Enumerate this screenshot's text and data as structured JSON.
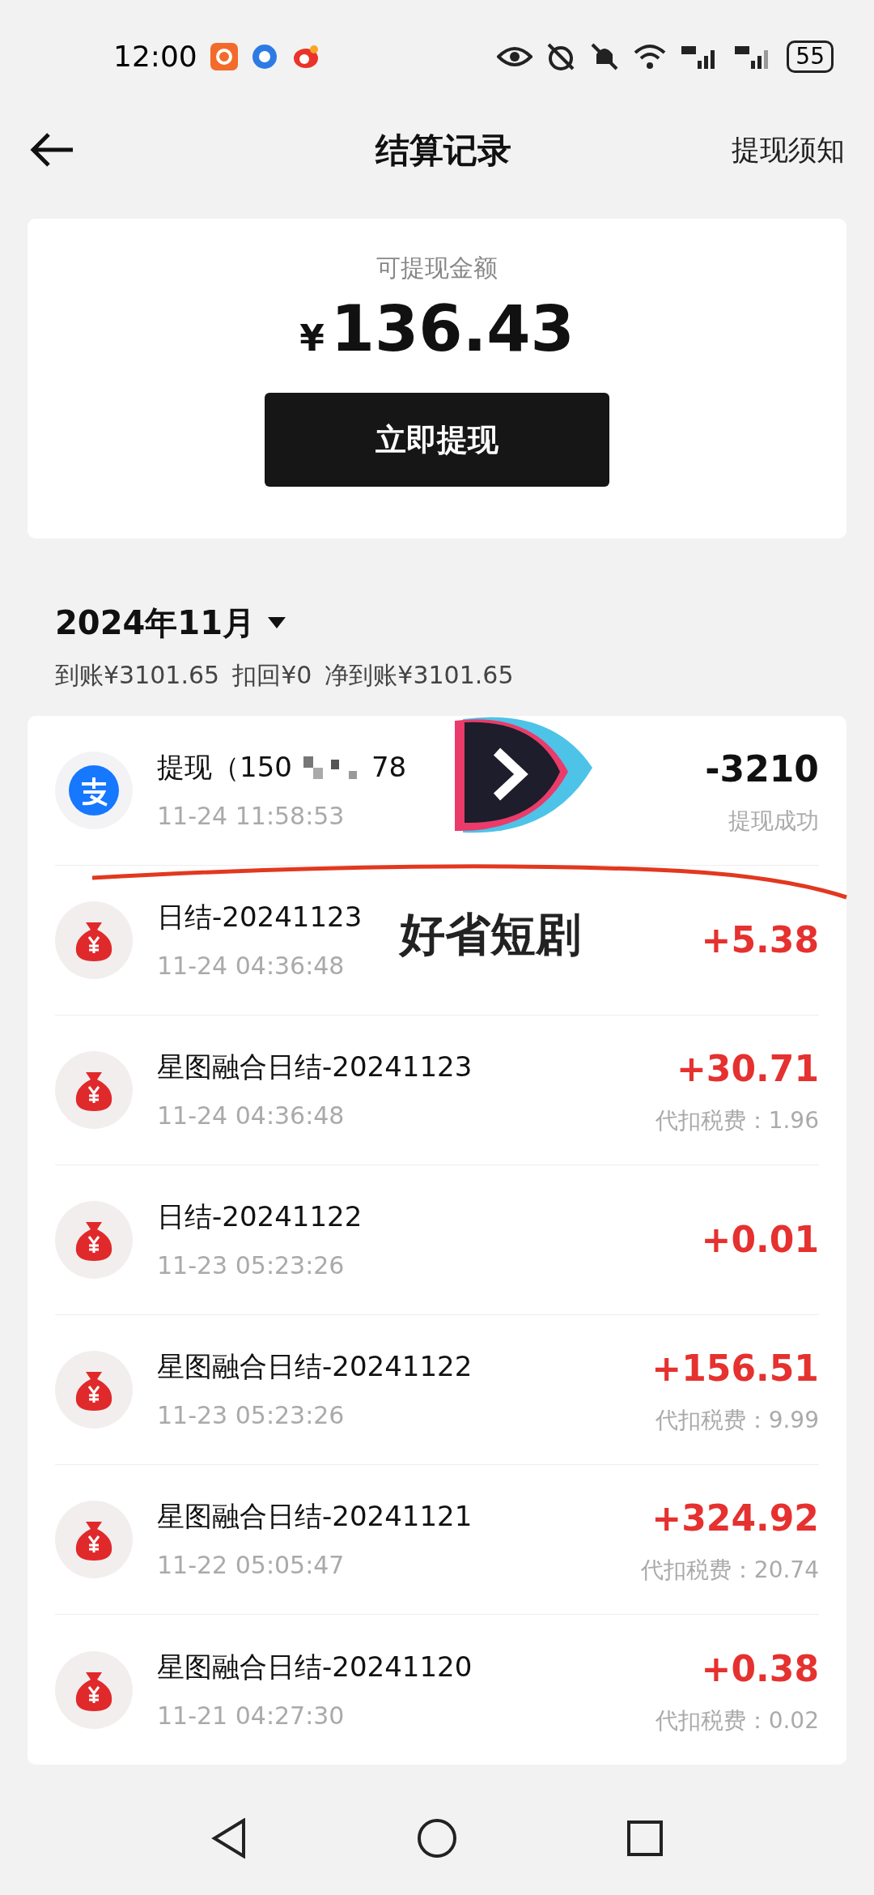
{
  "status_bar": {
    "time": "12:00",
    "battery": "55"
  },
  "header": {
    "title": "结算记录",
    "action": "提现须知"
  },
  "balance": {
    "label": "可提现金额",
    "currency": "¥",
    "amount": "136.43",
    "button": "立即提现"
  },
  "month": {
    "label": "2024年11月",
    "summary": [
      "到账¥3101.65",
      "扣回¥0",
      "净到账¥3101.65"
    ]
  },
  "records": [
    {
      "kind": "withdraw",
      "title": "提现（150",
      "title_tail": "78",
      "time": "11-24 11:58:53",
      "amount": "-3210",
      "note": "提现成功"
    },
    {
      "kind": "income",
      "title": "日结-20241123",
      "time": "11-24 04:36:48",
      "amount": "+5.38"
    },
    {
      "kind": "income",
      "title": "星图融合日结-20241123",
      "time": "11-24 04:36:48",
      "amount": "+30.71",
      "note": "代扣税费：1.96"
    },
    {
      "kind": "income",
      "title": "日结-20241122",
      "time": "11-23 05:23:26",
      "amount": "+0.01"
    },
    {
      "kind": "income",
      "title": "星图融合日结-20241122",
      "time": "11-23 05:23:26",
      "amount": "+156.51",
      "note": "代扣税费：9.99"
    },
    {
      "kind": "income",
      "title": "星图融合日结-20241121",
      "time": "11-22 05:05:47",
      "amount": "+324.92",
      "note": "代扣税费：20.74"
    },
    {
      "kind": "income",
      "title": "星图融合日结-20241120",
      "time": "11-21 04:27:30",
      "amount": "+0.38",
      "note": "代扣税费：0.02"
    }
  ],
  "overlay": {
    "caption": "好省短剧"
  }
}
